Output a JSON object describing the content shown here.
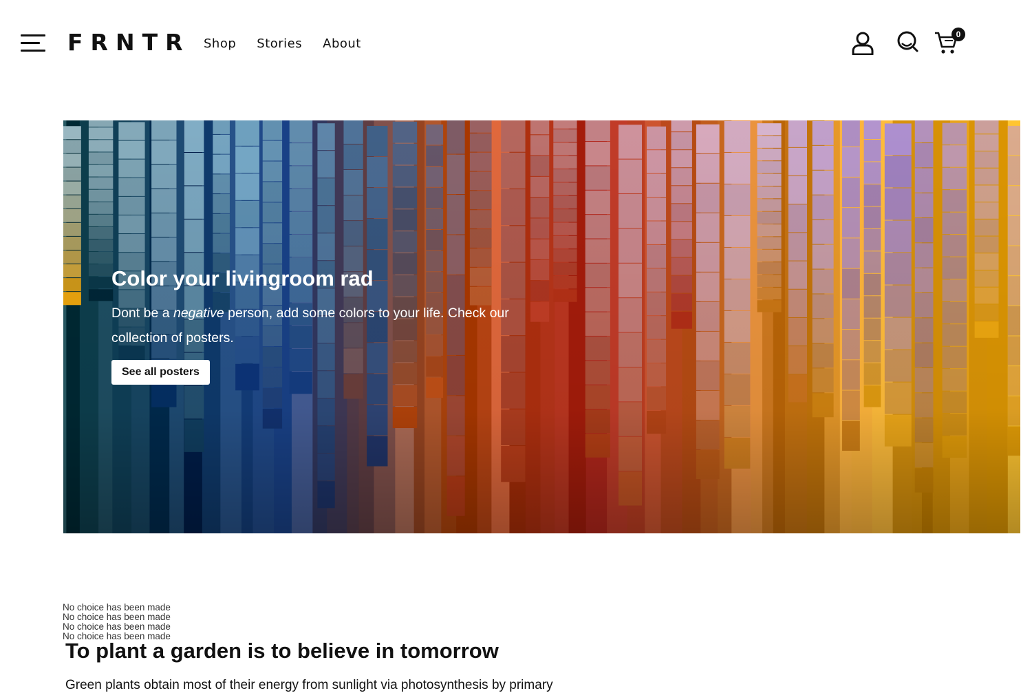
{
  "brand": {
    "logo": "FRNTR"
  },
  "nav": [
    {
      "label": "Shop"
    },
    {
      "label": "Stories"
    },
    {
      "label": "About"
    }
  ],
  "header": {
    "cart_count": "0",
    "icons": [
      "menu-icon",
      "user-icon",
      "search-icon",
      "cart-icon"
    ]
  },
  "hero": {
    "title": "Color your livingroom rad",
    "text_before": "Dont be a ",
    "text_emphasis": "negative",
    "text_after": " person, add some colors to your life. Check our collection of posters.",
    "button_label": "See all posters",
    "image": "hanging paint color swatch strips"
  },
  "notices": [
    "No choice has been made",
    "No choice has been made",
    "No choice has been made",
    "No choice has been made"
  ],
  "section": {
    "title": "To plant a garden is to believe in tomorrow",
    "text": "Green plants obtain most of their energy from sunlight via photosynthesis by primary"
  },
  "colors": {
    "text": "#111111",
    "background": "#ffffff",
    "button_bg": "#ffffff"
  }
}
